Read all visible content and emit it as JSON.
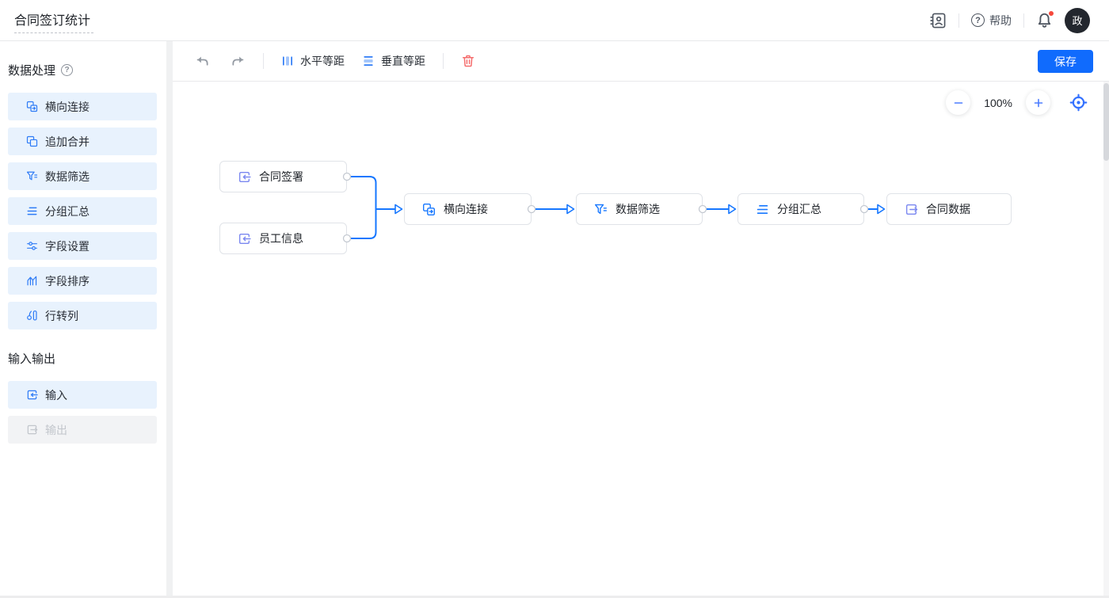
{
  "header": {
    "title": "合同签订统计",
    "help_label": "帮助",
    "avatar_text": "政"
  },
  "sidebar": {
    "sections": [
      {
        "title": "数据处理",
        "items": [
          {
            "label": "横向连接",
            "icon": "join-icon",
            "enabled": true
          },
          {
            "label": "追加合并",
            "icon": "append-merge-icon",
            "enabled": true
          },
          {
            "label": "数据筛选",
            "icon": "filter-icon",
            "enabled": true
          },
          {
            "label": "分组汇总",
            "icon": "group-summary-icon",
            "enabled": true
          },
          {
            "label": "字段设置",
            "icon": "field-settings-icon",
            "enabled": true
          },
          {
            "label": "字段排序",
            "icon": "field-sort-icon",
            "enabled": true
          },
          {
            "label": "行转列",
            "icon": "row-to-column-icon",
            "enabled": true
          }
        ]
      },
      {
        "title": "输入输出",
        "items": [
          {
            "label": "输入",
            "icon": "input-icon",
            "enabled": true
          },
          {
            "label": "输出",
            "icon": "output-icon",
            "enabled": false
          }
        ]
      }
    ]
  },
  "toolbar": {
    "horizontal_spacing_label": "水平等距",
    "vertical_spacing_label": "垂直等距",
    "save_label": "保存"
  },
  "canvas": {
    "zoom_level": "100%",
    "nodes": [
      {
        "label": "合同签署",
        "type": "input"
      },
      {
        "label": "员工信息",
        "type": "input"
      },
      {
        "label": "横向连接",
        "type": "join"
      },
      {
        "label": "数据筛选",
        "type": "filter"
      },
      {
        "label": "分组汇总",
        "type": "group-summary"
      },
      {
        "label": "合同数据",
        "type": "output"
      }
    ]
  },
  "colors": {
    "accent": "#106bfd",
    "connector_blue": "#1677ff",
    "process_icon_blue": "#1677ff",
    "io_icon_blue": "#7b88f0",
    "sidebar_item_bg": "#e8f2fd",
    "disabled_bg": "#f2f3f5",
    "trash_red": "#f56c6c",
    "notification_red": "#f5483b"
  }
}
